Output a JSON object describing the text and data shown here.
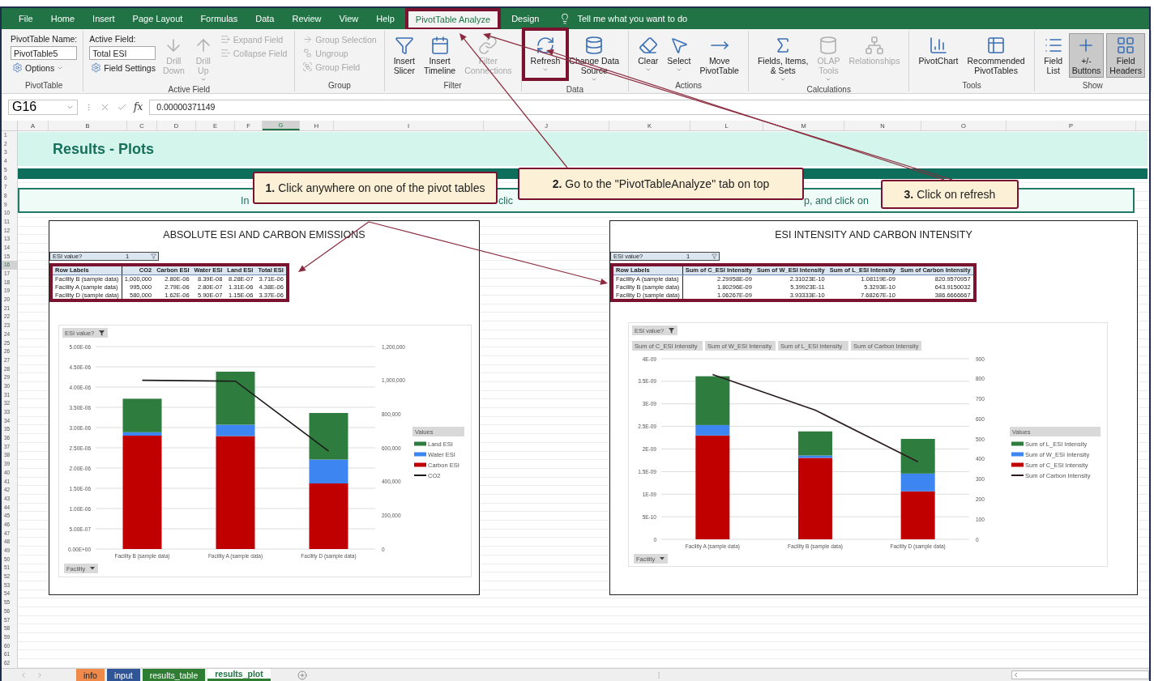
{
  "ribbon_tabs": [
    {
      "label": "File",
      "selected": false,
      "highlighted": false
    },
    {
      "label": "Home",
      "selected": false,
      "highlighted": false
    },
    {
      "label": "Insert",
      "selected": false,
      "highlighted": false
    },
    {
      "label": "Page Layout",
      "selected": false,
      "highlighted": false
    },
    {
      "label": "Formulas",
      "selected": false,
      "highlighted": false
    },
    {
      "label": "Data",
      "selected": false,
      "highlighted": false
    },
    {
      "label": "Review",
      "selected": false,
      "highlighted": false
    },
    {
      "label": "View",
      "selected": false,
      "highlighted": false
    },
    {
      "label": "Help",
      "selected": false,
      "highlighted": false
    },
    {
      "label": "PivotTable Analyze",
      "selected": true,
      "highlighted": true
    },
    {
      "label": "Design",
      "selected": false,
      "highlighted": false
    }
  ],
  "tell_me": {
    "placeholder": "Tell me what you want to do"
  },
  "ribbon_groups": [
    {
      "label": "PivotTable",
      "columns": [
        [
          {
            "kind": "caption",
            "label": "PivotTable Name:"
          },
          {
            "kind": "input",
            "value": "PivotTable5"
          },
          {
            "kind": "small",
            "label": "Options",
            "dropdown": true,
            "disabled": false
          }
        ]
      ]
    },
    {
      "label": "Active Field",
      "columns": [
        [
          {
            "kind": "caption",
            "label": "Active Field:"
          },
          {
            "kind": "input",
            "value": "Total ESI"
          },
          {
            "kind": "small",
            "label": "Field Settings",
            "dropdown": false,
            "disabled": false
          }
        ],
        [
          {
            "kind": "large",
            "lines": [
              "Drill",
              "Down"
            ],
            "dropdown": false,
            "disabled": true,
            "selected": false,
            "highlighted": false
          }
        ],
        [
          {
            "kind": "large",
            "lines": [
              "Drill",
              "Up"
            ],
            "dropdown": true,
            "disabled": true,
            "selected": false,
            "highlighted": false
          }
        ],
        [
          {
            "kind": "small",
            "label": "Expand Field",
            "dropdown": false,
            "disabled": true
          },
          {
            "kind": "small",
            "label": "Collapse Field",
            "dropdown": false,
            "disabled": true
          }
        ]
      ]
    },
    {
      "label": "Group",
      "columns": [
        [
          {
            "kind": "small",
            "label": "Group Selection",
            "dropdown": false,
            "disabled": true
          },
          {
            "kind": "small",
            "label": "Ungroup",
            "dropdown": false,
            "disabled": true
          },
          {
            "kind": "small",
            "label": "Group Field",
            "dropdown": false,
            "disabled": true
          }
        ]
      ]
    },
    {
      "label": "Filter",
      "columns": [
        [
          {
            "kind": "large",
            "lines": [
              "Insert",
              "Slicer"
            ],
            "dropdown": false,
            "disabled": false,
            "selected": false,
            "highlighted": false
          }
        ],
        [
          {
            "kind": "large",
            "lines": [
              "Insert",
              "Timeline"
            ],
            "dropdown": false,
            "disabled": false,
            "selected": false,
            "highlighted": false
          }
        ],
        [
          {
            "kind": "large",
            "lines": [
              "Filter",
              "Connections"
            ],
            "dropdown": false,
            "disabled": true,
            "selected": false,
            "highlighted": false
          }
        ]
      ]
    },
    {
      "label": "Data",
      "columns": [
        [
          {
            "kind": "large",
            "lines": [
              "Refresh"
            ],
            "dropdown": true,
            "disabled": false,
            "selected": false,
            "highlighted": true
          }
        ],
        [
          {
            "kind": "large",
            "lines": [
              "Change Data",
              "Source"
            ],
            "dropdown": true,
            "disabled": false,
            "selected": false,
            "highlighted": false
          }
        ]
      ]
    },
    {
      "label": "Actions",
      "columns": [
        [
          {
            "kind": "large",
            "lines": [
              "Clear"
            ],
            "dropdown": true,
            "disabled": false,
            "selected": false,
            "highlighted": false
          }
        ],
        [
          {
            "kind": "large",
            "lines": [
              "Select"
            ],
            "dropdown": true,
            "disabled": false,
            "selected": false,
            "highlighted": false
          }
        ],
        [
          {
            "kind": "large",
            "lines": [
              "Move",
              "PivotTable"
            ],
            "dropdown": false,
            "disabled": false,
            "selected": false,
            "highlighted": false
          }
        ]
      ]
    },
    {
      "label": "Calculations",
      "columns": [
        [
          {
            "kind": "large",
            "lines": [
              "Fields, Items,",
              "& Sets"
            ],
            "dropdown": true,
            "disabled": false,
            "selected": false,
            "highlighted": false
          }
        ],
        [
          {
            "kind": "large",
            "lines": [
              "OLAP",
              "Tools"
            ],
            "dropdown": true,
            "disabled": true,
            "selected": false,
            "highlighted": false
          }
        ],
        [
          {
            "kind": "large",
            "lines": [
              "Relationships"
            ],
            "dropdown": false,
            "disabled": true,
            "selected": false,
            "highlighted": false
          }
        ]
      ]
    },
    {
      "label": "Tools",
      "columns": [
        [
          {
            "kind": "large",
            "lines": [
              "PivotChart"
            ],
            "dropdown": false,
            "disabled": false,
            "selected": false,
            "highlighted": false
          }
        ],
        [
          {
            "kind": "large",
            "lines": [
              "Recommended",
              "PivotTables"
            ],
            "dropdown": false,
            "disabled": false,
            "selected": false,
            "highlighted": false
          }
        ]
      ]
    },
    {
      "label": "Show",
      "columns": [
        [
          {
            "kind": "large",
            "lines": [
              "Field",
              "List"
            ],
            "dropdown": false,
            "disabled": false,
            "selected": false,
            "highlighted": false
          }
        ],
        [
          {
            "kind": "large",
            "lines": [
              "+/-",
              "Buttons"
            ],
            "dropdown": false,
            "disabled": false,
            "selected": true,
            "highlighted": false
          }
        ],
        [
          {
            "kind": "large",
            "lines": [
              "Field",
              "Headers"
            ],
            "dropdown": false,
            "disabled": false,
            "selected": true,
            "highlighted": false
          }
        ]
      ]
    }
  ],
  "formula_bar": {
    "cell": "G16",
    "function_label": "fx",
    "value": "0.00000371149"
  },
  "columns": [
    {
      "label": "A",
      "selected": false
    },
    {
      "label": "B",
      "selected": false
    },
    {
      "label": "C",
      "selected": false
    },
    {
      "label": "D",
      "selected": false
    },
    {
      "label": "E",
      "selected": false
    },
    {
      "label": "F",
      "selected": false
    },
    {
      "label": "G",
      "selected": true
    },
    {
      "label": "H",
      "selected": false
    },
    {
      "label": "I",
      "selected": false
    },
    {
      "label": "J",
      "selected": false
    },
    {
      "label": "K",
      "selected": false
    },
    {
      "label": "L",
      "selected": false
    },
    {
      "label": "M",
      "selected": false
    },
    {
      "label": "N",
      "selected": false
    },
    {
      "label": "O",
      "selected": false
    },
    {
      "label": "P",
      "selected": false
    }
  ],
  "rows": [
    {
      "label": "1",
      "selected": false
    },
    {
      "label": "2",
      "selected": false
    },
    {
      "label": "3",
      "selected": false
    },
    {
      "label": "4",
      "selected": false
    },
    {
      "label": "5",
      "selected": false
    },
    {
      "label": "6",
      "selected": false
    },
    {
      "label": "7",
      "selected": false
    },
    {
      "label": "8",
      "selected": false
    },
    {
      "label": "9",
      "selected": false
    },
    {
      "label": "10",
      "selected": false
    },
    {
      "label": "11",
      "selected": false
    },
    {
      "label": "12",
      "selected": false
    },
    {
      "label": "13",
      "selected": false
    },
    {
      "label": "14",
      "selected": false
    },
    {
      "label": "15",
      "selected": false
    },
    {
      "label": "16",
      "selected": true
    },
    {
      "label": "17",
      "selected": false
    },
    {
      "label": "18",
      "selected": false
    },
    {
      "label": "19",
      "selected": false
    },
    {
      "label": "20",
      "selected": false
    },
    {
      "label": "21",
      "selected": false
    },
    {
      "label": "22",
      "selected": false
    },
    {
      "label": "23",
      "selected": false
    },
    {
      "label": "24",
      "selected": false
    },
    {
      "label": "25",
      "selected": false
    },
    {
      "label": "26",
      "selected": false
    },
    {
      "label": "27",
      "selected": false
    },
    {
      "label": "28",
      "selected": false
    },
    {
      "label": "29",
      "selected": false
    },
    {
      "label": "30",
      "selected": false
    },
    {
      "label": "31",
      "selected": false
    },
    {
      "label": "32",
      "selected": false
    },
    {
      "label": "33",
      "selected": false
    },
    {
      "label": "34",
      "selected": false
    },
    {
      "label": "35",
      "selected": false
    },
    {
      "label": "36",
      "selected": false
    },
    {
      "label": "37",
      "selected": false
    },
    {
      "label": "38",
      "selected": false
    },
    {
      "label": "39",
      "selected": false
    },
    {
      "label": "40",
      "selected": false
    },
    {
      "label": "41",
      "selected": false
    },
    {
      "label": "42",
      "selected": false
    },
    {
      "label": "43",
      "selected": false
    },
    {
      "label": "44",
      "selected": false
    },
    {
      "label": "45",
      "selected": false
    },
    {
      "label": "46",
      "selected": false
    },
    {
      "label": "47",
      "selected": false
    },
    {
      "label": "48",
      "selected": false
    },
    {
      "label": "49",
      "selected": false
    },
    {
      "label": "50",
      "selected": false
    },
    {
      "label": "51",
      "selected": false
    },
    {
      "label": "52",
      "selected": false
    },
    {
      "label": "53",
      "selected": false
    },
    {
      "label": "54",
      "selected": false
    },
    {
      "label": "55",
      "selected": false
    },
    {
      "label": "56",
      "selected": false
    },
    {
      "label": "57",
      "selected": false
    },
    {
      "label": "58",
      "selected": false
    },
    {
      "label": "59",
      "selected": false
    },
    {
      "label": "60",
      "selected": false
    },
    {
      "label": "61",
      "selected": false
    },
    {
      "label": "62",
      "selected": false
    }
  ],
  "sheet_title": "Results - Plots",
  "instruction_fragments": [
    "In",
    "clic",
    "p, and click on"
  ],
  "callouts": [
    "**1.** Click anywhere on one of the pivot tables",
    "**2.** Go to the \"PivotTableAnalyze\" tab on top",
    "**3.** Click on refresh"
  ],
  "panels": [
    {
      "title": "ABSOLUTE ESI AND CARBON EMISSIONS",
      "pivot": {
        "filter_label": "ESI value?",
        "filter_value": "1",
        "highlighted": true,
        "columns": [
          "Row Labels",
          "CO2",
          "Carbon ESI",
          "Water ESI",
          "Land ESI",
          "Total ESI"
        ],
        "rows": [
          [
            "Facility B (sample data)",
            "1,000,000",
            "2.80E-06",
            "8.39E-08",
            "8.28E-07",
            "3.71E-06"
          ],
          [
            "Facility A (sample data)",
            "995,000",
            "2.79E-06",
            "2.80E-07",
            "1.31E-06",
            "4.38E-06"
          ],
          [
            "Facility D (sample data)",
            "580,000",
            "1.62E-06",
            "5.90E-07",
            "1.15E-06",
            "3.37E-06"
          ]
        ]
      },
      "chart": {
        "filter_button": "ESI value?",
        "axis_button": "Facility",
        "legend_title": "Values",
        "chart_data": {
          "type": "bar",
          "stacked": true,
          "grid": true,
          "legend": "right",
          "categories": [
            "Facility B (sample data)",
            "Facility A (sample data)",
            "Facility D (sample data)"
          ],
          "series": [
            {
              "name": "Carbon ESI",
              "type": "bar",
              "color": "#c00000",
              "values": [
                2.8e-06,
                2.79e-06,
                1.62e-06
              ]
            },
            {
              "name": "Water ESI",
              "type": "bar",
              "color": "#3d85f0",
              "values": [
                8.39e-08,
                2.8e-07,
                5.9e-07
              ]
            },
            {
              "name": "Land ESI",
              "type": "bar",
              "color": "#2e7d3e",
              "values": [
                8.28e-07,
                1.31e-06,
                1.15e-06
              ]
            },
            {
              "name": "CO2",
              "type": "line",
              "axis": "y2",
              "color": "#1a1a1a",
              "values": [
                1000000,
                995000,
                580000
              ]
            }
          ],
          "ylim": [
            0,
            5e-06
          ],
          "yticks": [
            {
              "value": 0,
              "label": "0.00E+00"
            },
            {
              "value": 5e-07,
              "label": "5.00E-07"
            },
            {
              "value": 1e-06,
              "label": "1.00E-06"
            },
            {
              "value": 1.5e-06,
              "label": "1.50E-06"
            },
            {
              "value": 2e-06,
              "label": "2.00E-06"
            },
            {
              "value": 2.5e-06,
              "label": "2.50E-06"
            },
            {
              "value": 3e-06,
              "label": "3.00E-06"
            },
            {
              "value": 3.5e-06,
              "label": "3.50E-06"
            },
            {
              "value": 4e-06,
              "label": "4.00E-06"
            },
            {
              "value": 4.5e-06,
              "label": "4.50E-06"
            },
            {
              "value": 5e-06,
              "label": "5.00E-06"
            }
          ],
          "y2lim": [
            0,
            1200000
          ],
          "y2ticks": [
            {
              "value": 0,
              "label": "0"
            },
            {
              "value": 200000,
              "label": "200,000"
            },
            {
              "value": 400000,
              "label": "400,000"
            },
            {
              "value": 600000,
              "label": "600,000"
            },
            {
              "value": 800000,
              "label": "800,000"
            },
            {
              "value": 1000000,
              "label": "1,000,000"
            },
            {
              "value": 1200000,
              "label": "1,200,000"
            }
          ]
        }
      }
    },
    {
      "title": "ESI INTENSITY AND CARBON INTENSITY",
      "pivot": {
        "filter_label": "ESI value?",
        "filter_value": "1",
        "highlighted": true,
        "columns": [
          "Row Labels",
          "Sum of C_ESI Intensity",
          "Sum of W_ESI Intensity",
          "Sum of L_ESI Intensity",
          "Sum of Carbon Intensity"
        ],
        "rows": [
          [
            "Facility A (sample data)",
            "2.29958E-09",
            "2.31023E-10",
            "1.08119E-09",
            "820.9570957"
          ],
          [
            "Facility B (sample data)",
            "1.80296E-09",
            "5.39923E-11",
            "5.3293E-10",
            "643.9150032"
          ],
          [
            "Facility D (sample data)",
            "1.06267E-09",
            "3.93333E-10",
            "7.68267E-10",
            "386.6666667"
          ]
        ]
      },
      "chart": {
        "filter_button": "ESI value?",
        "axis_button": "Facility",
        "legend_title": "Values",
        "field_buttons": [
          "Sum of C_ESI Intensity",
          "Sum of W_ESI Intensity",
          "Sum of L_ESI Intensity",
          "Sum of Carbon Intensity"
        ],
        "chart_data": {
          "type": "bar",
          "stacked": true,
          "grid": true,
          "legend": "right",
          "categories": [
            "Facility A (sample data)",
            "Facility B (sample data)",
            "Facility D (sample data)"
          ],
          "series": [
            {
              "name": "Sum of C_ESI Intensity",
              "type": "bar",
              "color": "#c00000",
              "values": [
                2.29958e-09,
                1.80296e-09,
                1.06267e-09
              ]
            },
            {
              "name": "Sum of W_ESI Intensity",
              "type": "bar",
              "color": "#3d85f0",
              "values": [
                2.31023e-10,
                5.39923e-11,
                3.93333e-10
              ]
            },
            {
              "name": "Sum of L_ESI Intensity",
              "type": "bar",
              "color": "#2e7d3e",
              "values": [
                1.08119e-09,
                5.3293e-10,
                7.68267e-10
              ]
            },
            {
              "name": "Sum of Carbon Intensity",
              "type": "line",
              "axis": "y2",
              "color": "#2a1a20",
              "values": [
                820.9570957,
                643.9150032,
                386.6666667
              ]
            }
          ],
          "ylim": [
            0,
            4e-09
          ],
          "yticks": [
            {
              "value": 0,
              "label": "0"
            },
            {
              "value": 5e-10,
              "label": "5E-10"
            },
            {
              "value": 1e-09,
              "label": "1E-09"
            },
            {
              "value": 1.5e-09,
              "label": "1.5E-09"
            },
            {
              "value": 2e-09,
              "label": "2E-09"
            },
            {
              "value": 2.5e-09,
              "label": "2.5E-09"
            },
            {
              "value": 3e-09,
              "label": "3E-09"
            },
            {
              "value": 3.5e-09,
              "label": "3.5E-09"
            },
            {
              "value": 4e-09,
              "label": "4E-09"
            }
          ],
          "y2lim": [
            0,
            900
          ],
          "y2ticks": [
            {
              "value": 0,
              "label": "0"
            },
            {
              "value": 100,
              "label": "100"
            },
            {
              "value": 200,
              "label": "200"
            },
            {
              "value": 300,
              "label": "300"
            },
            {
              "value": 400,
              "label": "400"
            },
            {
              "value": 500,
              "label": "500"
            },
            {
              "value": 600,
              "label": "600"
            },
            {
              "value": 700,
              "label": "700"
            },
            {
              "value": 800,
              "label": "800"
            },
            {
              "value": 900,
              "label": "900"
            }
          ]
        }
      }
    }
  ],
  "sheet_tabs": [
    {
      "label": "info",
      "selected": false,
      "color": "#f08a4b"
    },
    {
      "label": "input",
      "selected": false,
      "color": "#2f5597"
    },
    {
      "label": "results_table",
      "selected": false,
      "color": "#2e7d32"
    },
    {
      "label": "results_plot",
      "selected": true,
      "color": "#2e7d32"
    }
  ]
}
